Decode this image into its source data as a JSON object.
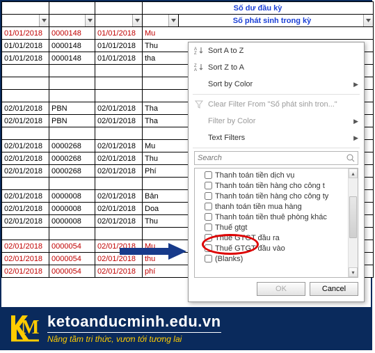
{
  "headers": {
    "opening_balance": "Số dư đầu kỳ",
    "period_arising": "Số phát sinh trong kỳ"
  },
  "rows": [
    {
      "d1": "01/01/2018",
      "code": "0000148",
      "d2": "01/01/2018",
      "txt": "Mu",
      "cls": "red"
    },
    {
      "d1": "01/01/2018",
      "code": "0000148",
      "d2": "01/01/2018",
      "txt": "Thu",
      "cls": ""
    },
    {
      "d1": "01/01/2018",
      "code": "0000148",
      "d2": "01/01/2018",
      "txt": "tha",
      "cls": ""
    },
    {
      "d1": "",
      "code": "",
      "d2": "",
      "txt": "",
      "cls": ""
    },
    {
      "d1": "",
      "code": "",
      "d2": "",
      "txt": "",
      "cls": ""
    },
    {
      "d1": "",
      "code": "",
      "d2": "",
      "txt": "",
      "cls": ""
    },
    {
      "d1": "02/01/2018",
      "code": "PBN",
      "d2": "02/01/2018",
      "txt": "Tha",
      "cls": ""
    },
    {
      "d1": "02/01/2018",
      "code": "PBN",
      "d2": "02/01/2018",
      "txt": "Tha",
      "cls": ""
    },
    {
      "d1": "",
      "code": "",
      "d2": "",
      "txt": "",
      "cls": ""
    },
    {
      "d1": "02/01/2018",
      "code": "0000268",
      "d2": "02/01/2018",
      "txt": "Mu",
      "cls": ""
    },
    {
      "d1": "02/01/2018",
      "code": "0000268",
      "d2": "02/01/2018",
      "txt": "Thu",
      "cls": ""
    },
    {
      "d1": "02/01/2018",
      "code": "0000268",
      "d2": "02/01/2018",
      "txt": "Phí",
      "cls": ""
    },
    {
      "d1": "",
      "code": "",
      "d2": "",
      "txt": "",
      "cls": ""
    },
    {
      "d1": "02/01/2018",
      "code": "0000008",
      "d2": "02/01/2018",
      "txt": "Bản",
      "cls": ""
    },
    {
      "d1": "02/01/2018",
      "code": "0000008",
      "d2": "02/01/2018",
      "txt": "Doa",
      "cls": ""
    },
    {
      "d1": "02/01/2018",
      "code": "0000008",
      "d2": "02/01/2018",
      "txt": "Thu",
      "cls": ""
    },
    {
      "d1": "",
      "code": "",
      "d2": "",
      "txt": "",
      "cls": ""
    },
    {
      "d1": "02/01/2018",
      "code": "0000054",
      "d2": "02/01/2018",
      "txt": "Mu",
      "cls": "red"
    },
    {
      "d1": "02/01/2018",
      "code": "0000054",
      "d2": "02/01/2018",
      "txt": "thu",
      "cls": "red"
    },
    {
      "d1": "02/01/2018",
      "code": "0000054",
      "d2": "02/01/2018",
      "txt": "phí",
      "cls": "red"
    }
  ],
  "menu": {
    "sort_az": "Sort A to Z",
    "sort_za": "Sort Z to A",
    "sort_color": "Sort by Color",
    "clear_filter": "Clear Filter From \"Số phát sinh tron...\"",
    "filter_color": "Filter by Color",
    "text_filters": "Text Filters",
    "search_placeholder": "Search",
    "items": [
      "Thanh toán tiền dịch vụ",
      "Thanh toán tiền hàng cho công t",
      "Thanh toán tiền hàng cho công ty",
      "thanh toán tiền mua hàng",
      "Thanh toán tiền thuê phòng khác",
      "Thuế gtgt",
      "Thuế GTGT đầu ra",
      "Thuế GTGT đầu vào",
      "(Blanks)"
    ],
    "ok": "OK",
    "cancel": "Cancel"
  },
  "footer": {
    "site": "ketoanducminh.edu.vn",
    "slogan": "Nâng tầm tri thức, vươn tới tương lai"
  }
}
